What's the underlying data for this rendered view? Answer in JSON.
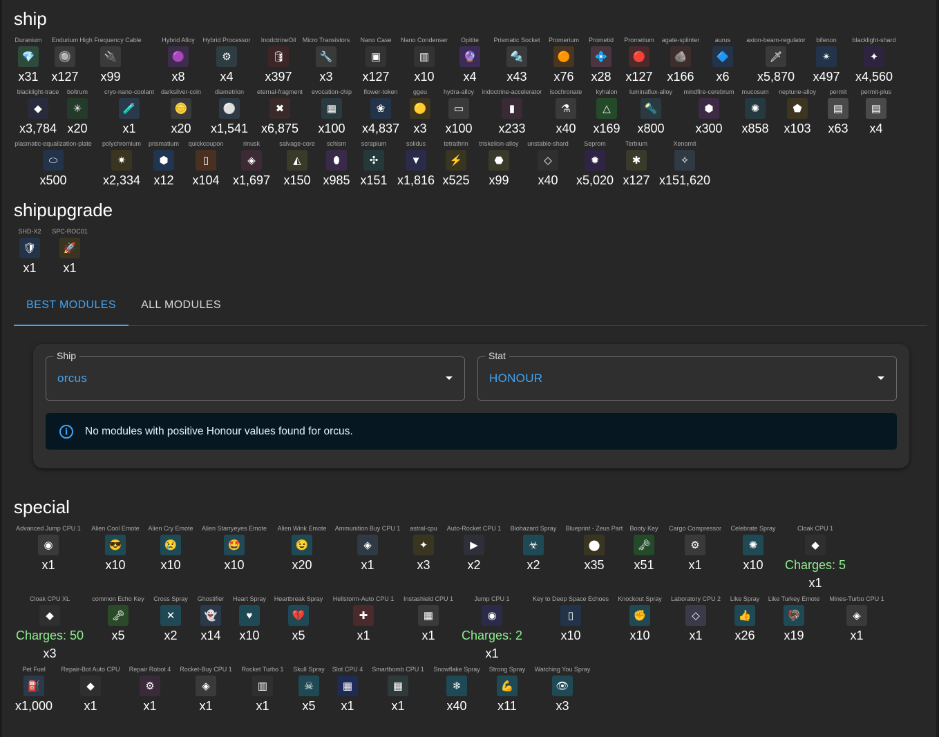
{
  "sections": {
    "ship": "ship",
    "shipupgrade": "shipupgrade",
    "special": "special"
  },
  "ship_rows": [
    [
      {
        "name": "Duranium",
        "count": "x31",
        "icon": "green-crystal-icon",
        "emoji": "💎",
        "bg": "#2e4a3a"
      },
      {
        "name": "Endurium",
        "count": "x127",
        "icon": "orb-icon",
        "emoji": "🔘",
        "bg": "#3a3a3a"
      },
      {
        "name": "High Frequency Cable",
        "count": "x99",
        "icon": "cable-icon",
        "emoji": "🔌",
        "bg": "#3a3a3a"
      },
      {
        "name": "Hybrid Alloy",
        "count": "x8",
        "icon": "purple-alloy-icon",
        "emoji": "🟣",
        "bg": "#3d2c4a"
      },
      {
        "name": "Hybrid Processor",
        "count": "x4",
        "icon": "processor-icon",
        "emoji": "⚙",
        "bg": "#2d3d42"
      },
      {
        "name": "InodctrineOil",
        "count": "x397",
        "icon": "oil-icon",
        "emoji": "🛢",
        "bg": "#3d2626"
      },
      {
        "name": "Micro Transistors",
        "count": "x3",
        "icon": "transistor-icon",
        "emoji": "🔧",
        "bg": "#3a3a3a"
      },
      {
        "name": "Nano Case",
        "count": "x127",
        "icon": "case-icon",
        "emoji": "▣",
        "bg": "#333"
      },
      {
        "name": "Nano Condenser",
        "count": "x10",
        "icon": "condenser-icon",
        "emoji": "▥",
        "bg": "#333"
      },
      {
        "name": "Opitite",
        "count": "x4",
        "icon": "purple-gem-icon",
        "emoji": "🔮",
        "bg": "#3d2c5a"
      },
      {
        "name": "Prismatic Socket",
        "count": "x43",
        "icon": "socket-icon",
        "emoji": "🔩",
        "bg": "#3a3a3a"
      },
      {
        "name": "Promerium",
        "count": "x76",
        "icon": "orange-ore-icon",
        "emoji": "🟠",
        "bg": "#4a3520"
      },
      {
        "name": "Prometid",
        "count": "x28",
        "icon": "pink-crystal-icon",
        "emoji": "💠",
        "bg": "#4a3540"
      },
      {
        "name": "Prometium",
        "count": "x127",
        "icon": "red-ore-icon",
        "emoji": "🔴",
        "bg": "#4a2a2a"
      },
      {
        "name": "agate-splinter",
        "count": "x166",
        "icon": "splinter-icon",
        "emoji": "🪨",
        "bg": "#3d2d2d"
      },
      {
        "name": "aurus",
        "count": "x6",
        "icon": "blue-crystal-icon",
        "emoji": "🔷",
        "bg": "#23344a"
      },
      {
        "name": "axion-beam-regulator",
        "count": "x5,870",
        "icon": "regulator-icon",
        "emoji": "🗡",
        "bg": "#3a3a3a"
      },
      {
        "name": "bifenon",
        "count": "x497",
        "icon": "blue-star-icon",
        "emoji": "✴",
        "bg": "#23344a"
      },
      {
        "name": "blacklight-shard",
        "count": "x4,560",
        "icon": "shard-icon",
        "emoji": "✦",
        "bg": "#2f2440"
      }
    ],
    [
      {
        "name": "blacklight-trace",
        "count": "x3,784",
        "icon": "trace-icon",
        "emoji": "◆",
        "bg": "#2a2a3d"
      },
      {
        "name": "boltrum",
        "count": "x20",
        "icon": "green-gem-icon",
        "emoji": "✳",
        "bg": "#243a2a"
      },
      {
        "name": "cryo-nano-coolant",
        "count": "x1",
        "icon": "coolant-icon",
        "emoji": "🧪",
        "bg": "#2a3a4a"
      },
      {
        "name": "darksilver-coin",
        "count": "x20",
        "icon": "coin-icon",
        "emoji": "🪙",
        "bg": "#3a3a3a"
      },
      {
        "name": "diametrion",
        "count": "x1,541",
        "icon": "sphere-icon",
        "emoji": "⚪",
        "bg": "#2f3a45"
      },
      {
        "name": "eternal-fragment",
        "count": "x6,875",
        "icon": "fragment-icon",
        "emoji": "✖",
        "bg": "#3a2a2a"
      },
      {
        "name": "evocation-chip",
        "count": "x100",
        "icon": "chip-icon",
        "emoji": "▦",
        "bg": "#2a3a40"
      },
      {
        "name": "flower-token",
        "count": "x4,837",
        "icon": "flower-icon",
        "emoji": "❀",
        "bg": "#23344a"
      },
      {
        "name": "ggeu",
        "count": "x3",
        "icon": "gold-coin-icon",
        "emoji": "🟡",
        "bg": "#3d3520"
      },
      {
        "name": "hydra-alloy",
        "count": "x100",
        "icon": "alloy-icon",
        "emoji": "▭",
        "bg": "#3a3a3a"
      },
      {
        "name": "indoctrine-accelerator",
        "count": "x233",
        "icon": "accelerator-icon",
        "emoji": "▮",
        "bg": "#3a2a35"
      },
      {
        "name": "isochronate",
        "count": "x40",
        "icon": "isochronate-icon",
        "emoji": "⚗",
        "bg": "#3a3a3a"
      },
      {
        "name": "kyhalon",
        "count": "x169",
        "icon": "triangle-icon",
        "emoji": "△",
        "bg": "#244a2a"
      },
      {
        "name": "luminaflux-alloy",
        "count": "x800",
        "icon": "luminaflux-icon",
        "emoji": "🔦",
        "bg": "#2a3a40"
      },
      {
        "name": "mindfire-cerebrum",
        "count": "x300",
        "icon": "cerebrum-icon",
        "emoji": "⬢",
        "bg": "#3d2a45"
      },
      {
        "name": "mucosum",
        "count": "x858",
        "icon": "mucosum-icon",
        "emoji": "✺",
        "bg": "#243a40"
      },
      {
        "name": "neptune-alloy",
        "count": "x103",
        "icon": "neptune-icon",
        "emoji": "⬟",
        "bg": "#3d3520"
      },
      {
        "name": "permit",
        "count": "x63",
        "icon": "permit-icon",
        "emoji": "▤",
        "bg": "#4a4a4a"
      },
      {
        "name": "permit-plus",
        "count": "x4",
        "icon": "permit-plus-icon",
        "emoji": "▤",
        "bg": "#4a4a4a"
      }
    ],
    [
      {
        "name": "plasmatic-equalization-plate",
        "count": "x500",
        "icon": "plate-icon",
        "emoji": "⬭",
        "bg": "#23344a"
      },
      {
        "name": "polychromium",
        "count": "x2,334",
        "icon": "polychromium-icon",
        "emoji": "✷",
        "bg": "#3a3520"
      },
      {
        "name": "prismatium",
        "count": "x12",
        "icon": "prismatium-icon",
        "emoji": "⬢",
        "bg": "#1f3550"
      },
      {
        "name": "quickcoupon",
        "count": "x104",
        "icon": "coupon-icon",
        "emoji": "▯",
        "bg": "#4a3020"
      },
      {
        "name": "rinusk",
        "count": "x1,697",
        "icon": "rinusk-icon",
        "emoji": "◈",
        "bg": "#3d2a35"
      },
      {
        "name": "salvage-core",
        "count": "x150",
        "icon": "core-icon",
        "emoji": "◭",
        "bg": "#3a3a2a"
      },
      {
        "name": "schism",
        "count": "x985",
        "icon": "schism-icon",
        "emoji": "⬮",
        "bg": "#3a2a4a"
      },
      {
        "name": "scrapium",
        "count": "x151",
        "icon": "scrapium-icon",
        "emoji": "✣",
        "bg": "#243a3a"
      },
      {
        "name": "solidus",
        "count": "x1,816",
        "icon": "solidus-icon",
        "emoji": "▼",
        "bg": "#2a2a4a"
      },
      {
        "name": "tetrathrin",
        "count": "x525",
        "icon": "lightning-icon",
        "emoji": "⚡",
        "bg": "#3a3520"
      },
      {
        "name": "triskelion-alloy",
        "count": "x99",
        "icon": "triskelion-icon",
        "emoji": "⬣",
        "bg": "#3a3a2a"
      },
      {
        "name": "unstable-shard",
        "count": "x40",
        "icon": "unstable-shard-icon",
        "emoji": "◇",
        "bg": "#2f2f2f"
      },
      {
        "name": "Seprom",
        "count": "x5,020",
        "icon": "seprom-icon",
        "emoji": "✹",
        "bg": "#2f2445"
      },
      {
        "name": "Terbium",
        "count": "x127",
        "icon": "terbium-icon",
        "emoji": "✱",
        "bg": "#3a3a2a"
      },
      {
        "name": "Xenomit",
        "count": "x151,620",
        "icon": "xenomit-icon",
        "emoji": "✧",
        "bg": "#2f3a45"
      }
    ]
  ],
  "shipupgrade": [
    {
      "name": "SHD-X2",
      "count": "x1",
      "icon": "shield-upgrade-icon",
      "emoji": "🛡",
      "bg": "#23344a"
    },
    {
      "name": "SPC-ROC01",
      "count": "x1",
      "icon": "rocket-upgrade-icon",
      "emoji": "🚀",
      "bg": "#3a3520"
    }
  ],
  "tabs": {
    "best": "BEST MODULES",
    "all": "ALL MODULES"
  },
  "form": {
    "ship_label": "Ship",
    "ship_value": "orcus",
    "stat_label": "Stat",
    "stat_value": "HONOUR",
    "info_icon": "i",
    "alert_text": "No modules with positive Honour values found for orcus."
  },
  "special_rows": [
    [
      {
        "name": "Advanced Jump CPU 1",
        "count": "x1",
        "icon": "jump-cpu-icon",
        "emoji": "◉",
        "bg": "#3a3a3a"
      },
      {
        "name": "Alien Cool Emote",
        "count": "x10",
        "icon": "alien-cool-icon",
        "emoji": "😎",
        "bg": "#1f4a55"
      },
      {
        "name": "Alien Cry Emote",
        "count": "x10",
        "icon": "alien-cry-icon",
        "emoji": "😢",
        "bg": "#1f4a55"
      },
      {
        "name": "Alien Starryeyes Emote",
        "count": "x10",
        "icon": "alien-starry-icon",
        "emoji": "🤩",
        "bg": "#1f4a55"
      },
      {
        "name": "Alien Wink Emote",
        "count": "x20",
        "icon": "alien-wink-icon",
        "emoji": "😉",
        "bg": "#1f4a55"
      },
      {
        "name": "Ammunition Buy CPU 1",
        "count": "x1",
        "icon": "ammo-cpu-icon",
        "emoji": "◈",
        "bg": "#2f3a45"
      },
      {
        "name": "astral-cpu",
        "count": "x3",
        "icon": "astral-cpu-icon",
        "emoji": "✦",
        "bg": "#3a3520"
      },
      {
        "name": "Auto-Rocket CPU 1",
        "count": "x2",
        "icon": "auto-rocket-icon",
        "emoji": "▶",
        "bg": "#2f2f3a"
      },
      {
        "name": "Biohazard Spray",
        "count": "x2",
        "icon": "biohazard-icon",
        "emoji": "☣",
        "bg": "#1f4a55"
      },
      {
        "name": "Blueprint - Zeus Part",
        "count": "x35",
        "icon": "blueprint-icon",
        "emoji": "⬤",
        "bg": "#3a3520"
      },
      {
        "name": "Booty Key",
        "count": "x51",
        "icon": "key-icon",
        "emoji": "🗝",
        "bg": "#244a2a"
      },
      {
        "name": "Cargo Compressor",
        "count": "x1",
        "icon": "compressor-icon",
        "emoji": "⚙",
        "bg": "#3a3a3a"
      },
      {
        "name": "Celebrate Spray",
        "count": "x10",
        "icon": "celebrate-icon",
        "emoji": "✺",
        "bg": "#1f4a55"
      },
      {
        "name": "Cloak CPU 1",
        "count": "x1",
        "charges": "Charges: 5",
        "icon": "cloak-cpu-icon",
        "emoji": "◆",
        "bg": "#2f2f2f"
      }
    ],
    [
      {
        "name": "Cloak CPU XL",
        "count": "x3",
        "charges": "Charges: 50",
        "icon": "cloak-cpu-xl-icon",
        "emoji": "◆",
        "bg": "#2f2f2f"
      },
      {
        "name": "common Echo Key",
        "count": "x5",
        "icon": "echo-key-icon",
        "emoji": "🗝",
        "bg": "#2a4a2a"
      },
      {
        "name": "Cross Spray",
        "count": "x2",
        "icon": "cross-icon",
        "emoji": "✕",
        "bg": "#1f4a55"
      },
      {
        "name": "Ghostifier",
        "count": "x14",
        "icon": "ghost-icon",
        "emoji": "👻",
        "bg": "#2a3a4a"
      },
      {
        "name": "Heart Spray",
        "count": "x10",
        "icon": "heart-icon",
        "emoji": "♥",
        "bg": "#1f4a55"
      },
      {
        "name": "Heartbreak Spray",
        "count": "x5",
        "icon": "heartbreak-icon",
        "emoji": "💔",
        "bg": "#1f4a55"
      },
      {
        "name": "Hellstorm-Auto CPU 1",
        "count": "x1",
        "icon": "hellstorm-icon",
        "emoji": "✚",
        "bg": "#4a2a2a"
      },
      {
        "name": "Instashield CPU 1",
        "count": "x1",
        "icon": "instashield-icon",
        "emoji": "▦",
        "bg": "#3a3a3a"
      },
      {
        "name": "Jump CPU 1",
        "count": "x1",
        "charges": "Charges: 2",
        "icon": "jump-icon",
        "emoji": "◉",
        "bg": "#2a2a4a"
      },
      {
        "name": "Key to Deep Space Echoes",
        "count": "x10",
        "icon": "deep-space-key-icon",
        "emoji": "▯",
        "bg": "#23344a"
      },
      {
        "name": "Knockout Spray",
        "count": "x10",
        "icon": "knockout-icon",
        "emoji": "✊",
        "bg": "#1f4a55"
      },
      {
        "name": "Laboratory CPU 2",
        "count": "x1",
        "icon": "laboratory-icon",
        "emoji": "◇",
        "bg": "#3a3a4a"
      },
      {
        "name": "Like Spray",
        "count": "x26",
        "icon": "like-icon",
        "emoji": "👍",
        "bg": "#1f4a55"
      },
      {
        "name": "Like Turkey Emote",
        "count": "x19",
        "icon": "turkey-icon",
        "emoji": "🦃",
        "bg": "#1f4a55"
      },
      {
        "name": "Mines-Turbo CPU 1",
        "count": "x1",
        "icon": "mines-turbo-icon",
        "emoji": "◈",
        "bg": "#3a3a3a"
      }
    ],
    [
      {
        "name": "Pet Fuel",
        "count": "x1,000",
        "icon": "fuel-icon",
        "emoji": "⛽",
        "bg": "#2a3a4a"
      },
      {
        "name": "Repair-Bot Auto CPU",
        "count": "x1",
        "icon": "repair-bot-icon",
        "emoji": "◆",
        "bg": "#2f2f2f"
      },
      {
        "name": "Repair Robot 4",
        "count": "x1",
        "icon": "repair-robot-icon",
        "emoji": "⚙",
        "bg": "#3a2a3a"
      },
      {
        "name": "Rocket-Buy CPU 1",
        "count": "x1",
        "icon": "rocket-buy-icon",
        "emoji": "◈",
        "bg": "#3a3a3a"
      },
      {
        "name": "Rocket Turbo 1",
        "count": "x1",
        "icon": "rocket-turbo-icon",
        "emoji": "▥",
        "bg": "#2f2f2f"
      },
      {
        "name": "Skull Spray",
        "count": "x5",
        "icon": "skull-icon",
        "emoji": "☠",
        "bg": "#1f4a55"
      },
      {
        "name": "Slot CPU 4",
        "count": "x1",
        "icon": "slot-cpu-icon",
        "emoji": "▦",
        "bg": "#1f2a55"
      },
      {
        "name": "Smartbomb CPU 1",
        "count": "x1",
        "icon": "smartbomb-icon",
        "emoji": "▦",
        "bg": "#2f3a3a"
      },
      {
        "name": "Snowflake Spray",
        "count": "x40",
        "icon": "snowflake-icon",
        "emoji": "❄",
        "bg": "#1f4a55"
      },
      {
        "name": "Strong Spray",
        "count": "x11",
        "icon": "strong-icon",
        "emoji": "💪",
        "bg": "#1f4a55"
      },
      {
        "name": "Watching You Spray",
        "count": "x3",
        "icon": "eye-icon",
        "emoji": "👁",
        "bg": "#1f4a55"
      }
    ]
  ]
}
